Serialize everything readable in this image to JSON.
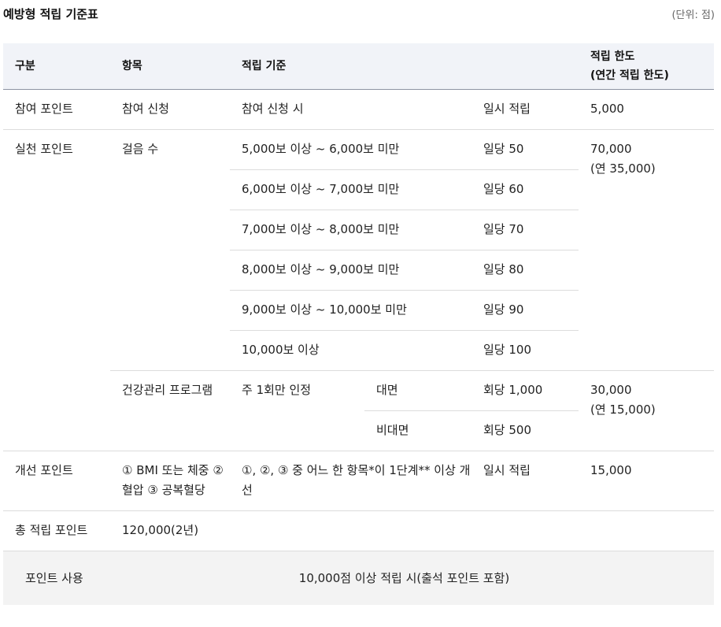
{
  "title": "예방형 적립 기준표",
  "unit": "(단위: 점)",
  "headers": {
    "category": "구분",
    "item": "항목",
    "criteria": "적립 기준",
    "limit_line1": "적립 한도",
    "limit_line2": "(연간 적립 한도)"
  },
  "participation": {
    "category": "참여 포인트",
    "item": "참여 신청",
    "criteria": "참여 신청 시",
    "rate": "일시 적립",
    "limit": "5,000"
  },
  "practice": {
    "category": "실천 포인트",
    "steps_item": "걸음 수",
    "steps": [
      {
        "range": "5,000보 이상 ~ 6,000보 미만",
        "rate": "일당 50"
      },
      {
        "range": "6,000보 이상 ~ 7,000보 미만",
        "rate": "일당 60"
      },
      {
        "range": "7,000보 이상 ~ 8,000보 미만",
        "rate": "일당 70"
      },
      {
        "range": "8,000보 이상 ~ 9,000보 미만",
        "rate": "일당 80"
      },
      {
        "range": "9,000보 이상 ~ 10,000보 미만",
        "rate": "일당 90"
      },
      {
        "range": "10,000보 이상",
        "rate": "일당 100"
      }
    ],
    "steps_limit_line1": "70,000",
    "steps_limit_line2": "(연 35,000)",
    "program_item": "건강관리 프로그램",
    "program_criteria": "주 1회만 인정",
    "program_rows": [
      {
        "type": "대면",
        "rate": "회당 1,000"
      },
      {
        "type": "비대면",
        "rate": "회당 500"
      }
    ],
    "program_limit_line1": "30,000",
    "program_limit_line2": "(연 15,000)"
  },
  "improvement": {
    "category": "개선 포인트",
    "item": "① BMI 또는 체중 ② 혈압 ③ 공복혈당",
    "criteria": "①, ②, ③ 중 어느 한 항목*이 1단계** 이상 개선",
    "rate": "일시 적립",
    "limit": "15,000"
  },
  "total": {
    "label": "총 적립 포인트",
    "value": "120,000(2년)"
  },
  "usage": {
    "label": "포인트 사용",
    "text": "10,000점 이상 적립 시(출석 포인트 포함)"
  }
}
